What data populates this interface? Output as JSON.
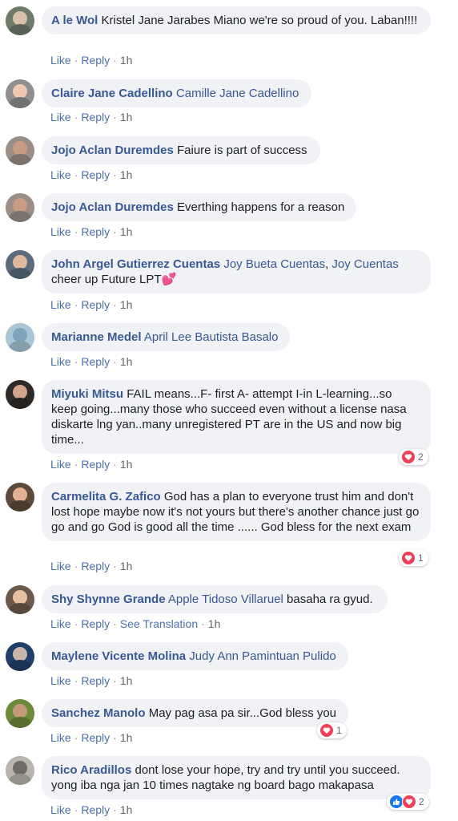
{
  "labels": {
    "like": "Like",
    "reply": "Reply",
    "see_translation": "See Translation"
  },
  "comments": [
    {
      "author": "A le Wol",
      "tags": [],
      "text": "Kristel Jane Jarabes Miano we're so proud of you. Laban!!!!",
      "time": "1h"
    },
    {
      "author": "Claire Jane Cadellino",
      "tags": [
        "Camille Jane Cadellino"
      ],
      "text": "",
      "time": "1h"
    },
    {
      "author": "Jojo Aclan Duremdes",
      "tags": [],
      "text": "Faiure is part of success",
      "time": "1h"
    },
    {
      "author": "Jojo Aclan Duremdes",
      "tags": [],
      "text": "Everthing happens for a reason",
      "time": "1h"
    },
    {
      "author": "John Argel Gutierrez Cuentas",
      "tags": [
        "Joy Bueta Cuentas",
        "Joy Cuentas"
      ],
      "text": "cheer up Future LPT💕",
      "time": "1h"
    },
    {
      "author": "Marianne Medel",
      "tags": [
        "April Lee Bautista Basalo"
      ],
      "text": "",
      "time": "1h"
    },
    {
      "author": "Miyuki Mitsu",
      "tags": [],
      "text": "FAIL means...F- first A- attempt I-in L-learning...so keep going...many those who succeed even without a license nasa diskarte lng yan..many unregistered PT are in the US and now big time...",
      "time": "1h",
      "reactions": {
        "types": [
          "heart"
        ],
        "count": "2"
      }
    },
    {
      "author": "Carmelita G. Zafico",
      "tags": [],
      "text": "God has a plan to everyone trust him and don't lost hope maybe now it's not yours but there's another chance just go go and go God is good all the time ...... God bless for the next exam",
      "time": "1h",
      "reactions": {
        "types": [
          "heart"
        ],
        "count": "1"
      }
    },
    {
      "author": "Shy Shynne Grande",
      "tags": [
        "Apple Tidoso Villaruel"
      ],
      "text": "basaha ra gyud.",
      "time": "1h",
      "translation": true
    },
    {
      "author": "Maylene Vicente Molina",
      "tags": [
        "Judy Ann Pamintuan Pulido"
      ],
      "text": "",
      "time": "1h"
    },
    {
      "author": "Sanchez Manolo",
      "tags": [],
      "text": "May pag asa pa sir...God bless you",
      "time": "1h",
      "reactions": {
        "types": [
          "heart"
        ],
        "count": "1"
      }
    },
    {
      "author": "Rico Aradillos",
      "tags": [],
      "text": "dont lose your hope, try and try until you succeed. yong iba nga jan 10 times nagtake ng board bago makapasa",
      "time": "1h",
      "reactions": {
        "types": [
          "like",
          "heart"
        ],
        "count": "2"
      }
    }
  ],
  "colors": {
    "author": "#385898",
    "bubble": "#f0f2f5",
    "heart": "#f33e58",
    "like": "#1877f2"
  }
}
